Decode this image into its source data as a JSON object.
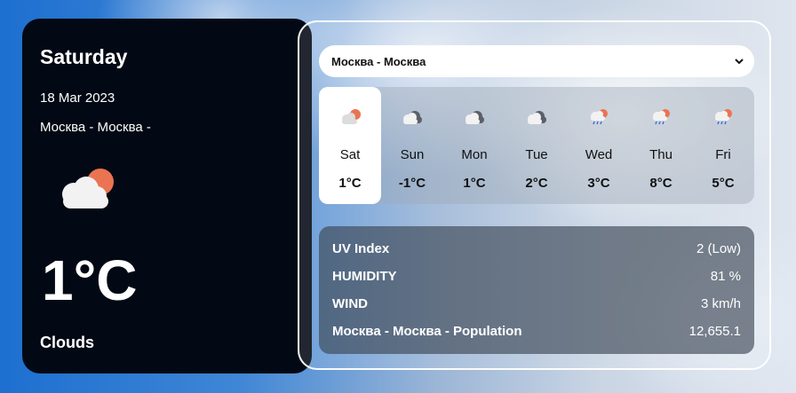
{
  "current": {
    "day": "Saturday",
    "date": "18 Mar 2023",
    "location": "Москва - Москва -",
    "temp": "1°C",
    "description": "Clouds",
    "icon": "cloud-sun-icon"
  },
  "selector": {
    "value": "Москва - Москва"
  },
  "forecast": [
    {
      "day": "Sat",
      "temp": "1°C",
      "icon": "cloud-sun-icon",
      "selected": true
    },
    {
      "day": "Sun",
      "temp": "-1°C",
      "icon": "cloud-icon",
      "selected": false
    },
    {
      "day": "Mon",
      "temp": "1°C",
      "icon": "cloud-icon",
      "selected": false
    },
    {
      "day": "Tue",
      "temp": "2°C",
      "icon": "cloud-icon",
      "selected": false
    },
    {
      "day": "Wed",
      "temp": "3°C",
      "icon": "cloud-sun-rain-icon",
      "selected": false
    },
    {
      "day": "Thu",
      "temp": "8°C",
      "icon": "cloud-sun-rain-icon",
      "selected": false
    },
    {
      "day": "Fri",
      "temp": "5°C",
      "icon": "cloud-sun-rain-icon",
      "selected": false
    }
  ],
  "stats": [
    {
      "label": "UV Index",
      "value": "2 (Low)"
    },
    {
      "label": "HUMIDITY",
      "value": "81 %"
    },
    {
      "label": "WIND",
      "value": "3 km/h"
    },
    {
      "label": "Москва - Москва - Population",
      "value": "12,655.1"
    }
  ],
  "colors": {
    "sun": "#ea7452",
    "cloud_light": "#f2f2f2",
    "cloud_dark": "#5b6068",
    "panel_dark": "#030914"
  }
}
